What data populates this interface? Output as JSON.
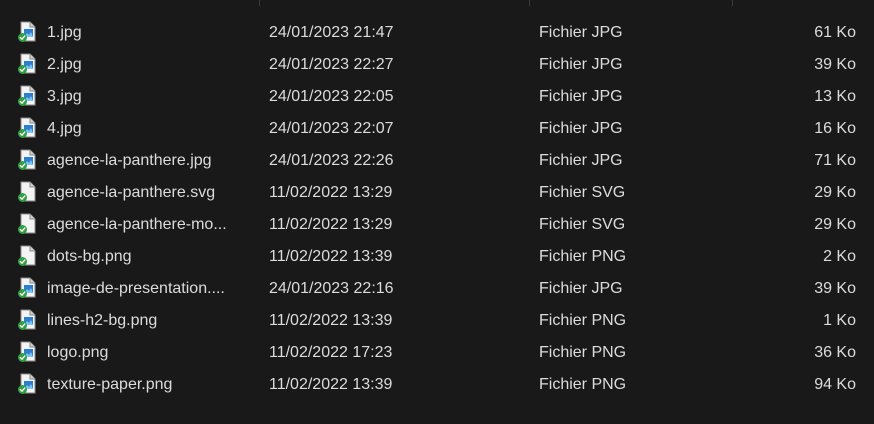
{
  "files": [
    {
      "name": "1.jpg",
      "date": "24/01/2023 21:47",
      "type": "Fichier JPG",
      "size": "61 Ko",
      "icon": "image"
    },
    {
      "name": "2.jpg",
      "date": "24/01/2023 22:27",
      "type": "Fichier JPG",
      "size": "39 Ko",
      "icon": "image"
    },
    {
      "name": "3.jpg",
      "date": "24/01/2023 22:05",
      "type": "Fichier JPG",
      "size": "13 Ko",
      "icon": "image"
    },
    {
      "name": "4.jpg",
      "date": "24/01/2023 22:07",
      "type": "Fichier JPG",
      "size": "16 Ko",
      "icon": "image"
    },
    {
      "name": "agence-la-panthere.jpg",
      "date": "24/01/2023 22:26",
      "type": "Fichier JPG",
      "size": "71 Ko",
      "icon": "image"
    },
    {
      "name": "agence-la-panthere.svg",
      "date": "11/02/2022 13:29",
      "type": "Fichier SVG",
      "size": "29 Ko",
      "icon": "blank"
    },
    {
      "name": "agence-la-panthere-mo...",
      "date": "11/02/2022 13:29",
      "type": "Fichier SVG",
      "size": "29 Ko",
      "icon": "blank"
    },
    {
      "name": "dots-bg.png",
      "date": "11/02/2022 13:39",
      "type": "Fichier PNG",
      "size": "2 Ko",
      "icon": "blank"
    },
    {
      "name": "image-de-presentation....",
      "date": "24/01/2023 22:16",
      "type": "Fichier JPG",
      "size": "39 Ko",
      "icon": "image"
    },
    {
      "name": "lines-h2-bg.png",
      "date": "11/02/2022 13:39",
      "type": "Fichier PNG",
      "size": "1 Ko",
      "icon": "image"
    },
    {
      "name": "logo.png",
      "date": "11/02/2022 17:23",
      "type": "Fichier PNG",
      "size": "36 Ko",
      "icon": "image"
    },
    {
      "name": "texture-paper.png",
      "date": "11/02/2022 13:39",
      "type": "Fichier PNG",
      "size": "94 Ko",
      "icon": "image"
    }
  ],
  "colors": {
    "background": "#191919",
    "text": "#dcdcdc",
    "sync_check": "#2ea043",
    "image_accent": "#2a7fd4"
  }
}
